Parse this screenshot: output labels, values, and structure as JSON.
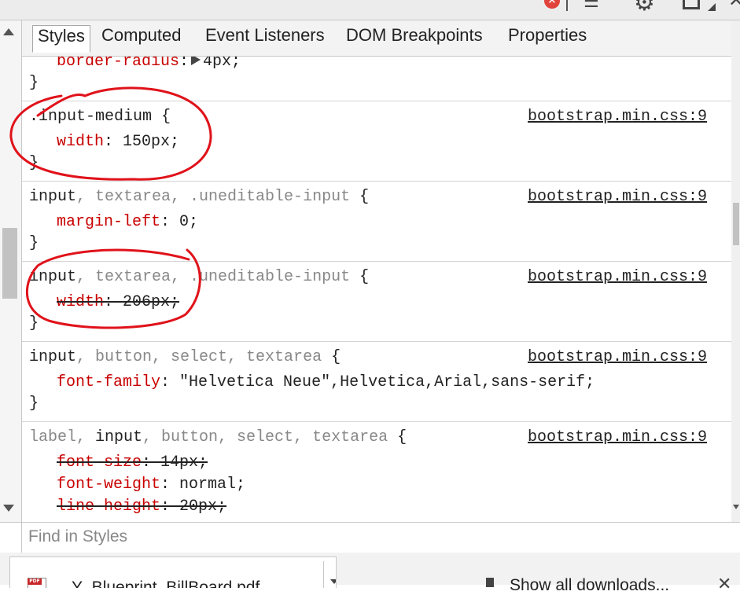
{
  "toolbar": {
    "error_glyph": "×",
    "console_glyph": "☰",
    "gear_glyph": "⚙",
    "close_glyph": "✕"
  },
  "tabs": [
    {
      "label": "Styles",
      "active": true
    },
    {
      "label": "Computed",
      "active": false
    },
    {
      "label": "Event Listeners",
      "active": false
    },
    {
      "label": "DOM Breakpoints",
      "active": false
    },
    {
      "label": "Properties",
      "active": false
    }
  ],
  "css_rules": {
    "r0": {
      "prop": "border-radius",
      "colon": ":",
      "value": "4px;",
      "close": "}"
    },
    "r1": {
      "selector": ".input-medium {",
      "source": "bootstrap.min.css:9",
      "prop": "width",
      "value": ": 150px;",
      "close": "}"
    },
    "r2": {
      "sel_a": "input",
      "sel_b": ", textarea, .uneditable-input",
      "brace": " {",
      "source": "bootstrap.min.css:9",
      "prop": "margin-left",
      "value": ": 0;",
      "close": "}"
    },
    "r3": {
      "sel_a": "input",
      "sel_b": ", textarea, .uneditable-input",
      "brace": " {",
      "source": "bootstrap.min.css:9",
      "prop": "width",
      "value": ": 206px;",
      "close": "}"
    },
    "r4": {
      "sel_a": "input",
      "sel_b": ", button, select, textarea",
      "brace": " {",
      "source": "bootstrap.min.css:9",
      "prop": "font-family",
      "value": ": \"Helvetica Neue\",Helvetica,Arial,sans-serif;",
      "close": "}"
    },
    "r5": {
      "sel_a": "label, ",
      "sel_b": "input",
      "sel_c": ", button, select, textarea",
      "brace": " {",
      "source": "bootstrap.min.css:9",
      "p1": "font-size",
      "v1": ": 14px;",
      "p2": "font-weight",
      "v2": ": normal;",
      "p3": "line-height",
      "v3": ": 20px;"
    }
  },
  "find": {
    "placeholder": "Find in Styles"
  },
  "download_bar": {
    "file_name": "Y_Blueprint_BillBoard.pdf",
    "show_all": "Show all downloads...",
    "close_glyph": "✕"
  },
  "colors": {
    "property": "#c80000",
    "annotation": "#e0121a",
    "dim_selector": "#888888"
  }
}
